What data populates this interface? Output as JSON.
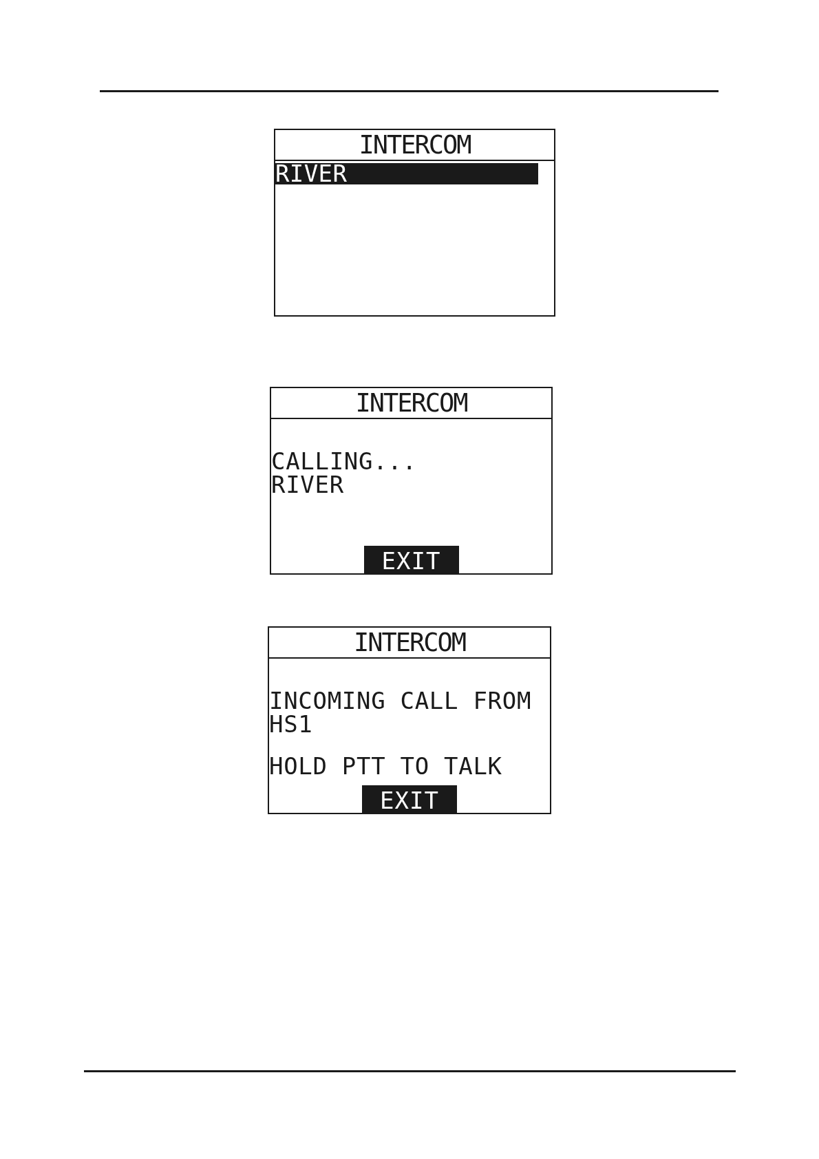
{
  "screens": [
    {
      "kind": "list",
      "title": "INTERCOM",
      "items": [
        {
          "label": "RIVER",
          "selected": true
        }
      ]
    },
    {
      "kind": "message",
      "title": "INTERCOM",
      "paragraphs": [
        [
          "CALLING...",
          "RIVER"
        ]
      ],
      "softkey": "EXIT"
    },
    {
      "kind": "message",
      "title": "INTERCOM",
      "paragraphs": [
        [
          "INCOMING CALL FROM",
          "HS1"
        ],
        [
          "HOLD PTT TO TALK"
        ]
      ],
      "softkey": "EXIT"
    }
  ]
}
